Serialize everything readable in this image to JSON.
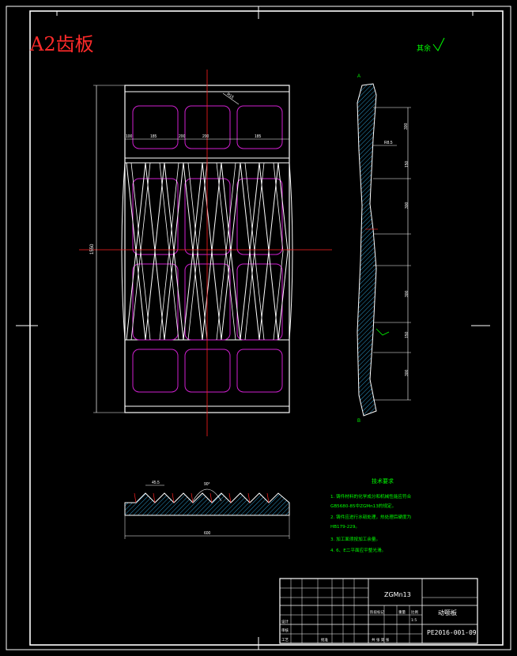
{
  "title": "A2齿板",
  "roughness_label": "其余",
  "tech_requirements": {
    "heading": "技术要求",
    "items": [
      "1. 铸件材料的化学成分和机械性能应符合",
      "GB5680-85中ZGMn13的规定。",
      "2. 铸件应进行水韧处理，热处理后硬度为",
      "HB179-229。",
      "3. 加工面须按加工余量。",
      "4. 6、E二平面应平整光滑。"
    ]
  },
  "title_block": {
    "material": "ZGMn13",
    "part_name": "动颚板",
    "drawing_number": "PE2016-001-09",
    "scale": "1:5",
    "labels": {
      "designer": "设计",
      "check": "审核",
      "process": "工艺",
      "approve": "批准",
      "stage": "阶段标记",
      "weight": "重量",
      "scale": "比例",
      "sheets": "共 张 第 张"
    }
  },
  "dimensions": {
    "main_width": "100",
    "slot_width": "200",
    "height_total": "1550",
    "bottom_total": "600",
    "tooth_angle": "90°",
    "tooth_pitch": "45.5",
    "thickness": "R8.5",
    "side_segments": [
      "300",
      "150",
      "300",
      "300",
      "150",
      "300"
    ],
    "top_dims": [
      "100",
      "185",
      "200",
      "200",
      "185"
    ],
    "r_label": "R15"
  },
  "section_labels": {
    "a": "A",
    "b": "B"
  }
}
